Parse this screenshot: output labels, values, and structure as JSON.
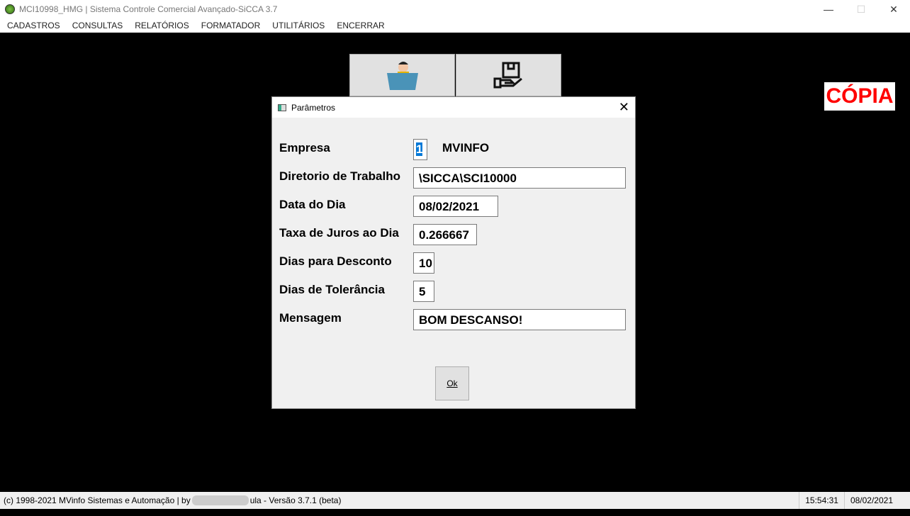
{
  "window": {
    "title": "MCI10998_HMG  |  Sistema Controle Comercial Avançado-SiCCA 3.7",
    "min": "—",
    "max": "☐",
    "close": "✕"
  },
  "menu": [
    "CADASTROS",
    "CONSULTAS",
    "RELATÓRIOS",
    "FORMATADOR",
    "UTILITÁRIOS",
    "ENCERRAR"
  ],
  "watermark": "CÓPIA",
  "dialog": {
    "title": "Parâmetros",
    "close": "✕",
    "fields": [
      {
        "label": "Empresa",
        "value": "1",
        "extra": "MVINFO"
      },
      {
        "label": "Diretorio de Trabalho",
        "value": "\\SICCA\\SCI10000"
      },
      {
        "label": "Data do Dia",
        "value": "08/02/2021"
      },
      {
        "label": "Taxa de Juros ao Dia",
        "value": "0.266667"
      },
      {
        "label": "Dias para Desconto",
        "value": "10"
      },
      {
        "label": "Dias de Tolerância",
        "value": "5"
      },
      {
        "label": "Mensagem",
        "value": "BOM DESCANSO!"
      }
    ],
    "ok": "Ok"
  },
  "status": {
    "left_a": "(c) 1998-2021 MVinfo Sistemas e Automação | by",
    "left_b": "ula - Versão 3.7.1 (beta)",
    "time": "15:54:31",
    "date": "08/02/2021"
  }
}
